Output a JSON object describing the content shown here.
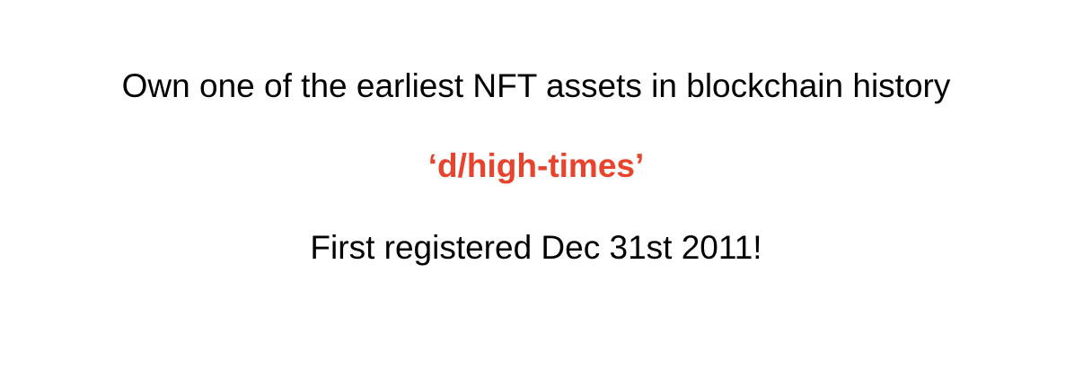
{
  "headline": "Own one of the earliest NFT assets in blockchain history",
  "asset_name": "‘d/high-times’",
  "registered": "First registered Dec 31st 2011!",
  "colors": {
    "accent": "#e8432d",
    "text": "#000000",
    "background": "#ffffff"
  }
}
